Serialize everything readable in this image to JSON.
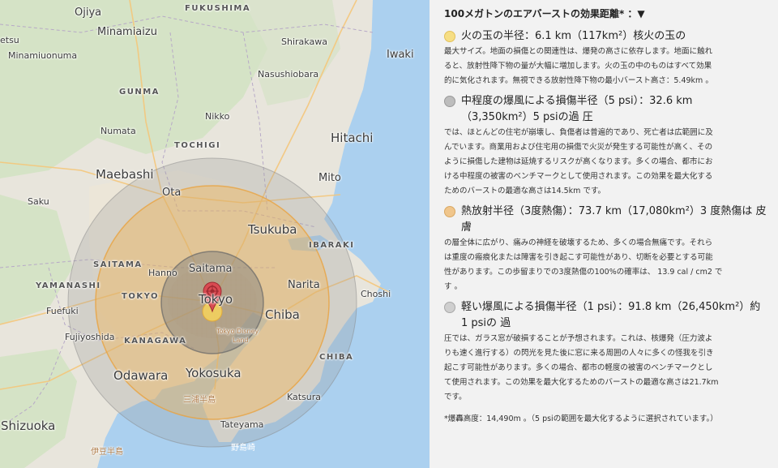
{
  "map": {
    "labels": {
      "ojiya": "Ojiya",
      "fukushima": "FUKUSHIMA",
      "minamiaizu": "Minamiaizu",
      "shirakawa": "Shirakawa",
      "iwaki": "Iwaki",
      "minamiuonuma": "Minamiuonuma",
      "nasushiobara": "Nasushiobara",
      "etsu": "etsu",
      "gunma": "GUNMA",
      "nikko": "Nikko",
      "hitachi": "Hitachi",
      "numata": "Numata",
      "tochigi": "TOCHIGI",
      "maebashi": "Maebashi",
      "mito": "Mito",
      "saku": "Saku",
      "ota": "Ota",
      "tsukuba": "Tsukuba",
      "ibaraki": "IBARAKI",
      "saitama_pref": "SAITAMA",
      "hanno": "Hanno",
      "saitama": "Saitama",
      "yamanashi": "YAMANASHI",
      "tokyo_pref": "TOKYO",
      "tokyo": "Tokyo",
      "narita": "Narita",
      "choshi": "Choshi",
      "fuefuki": "Fuefuki",
      "chiba": "Chiba",
      "fujiyoshida": "Fujiyoshida",
      "kanagawa": "KANAGAWA",
      "tokyo_disney": "Tokyo Disney",
      "land": "Land",
      "chiba_pref": "CHIBA",
      "odawara": "Odawara",
      "yokosuka": "Yokosuka",
      "katsura": "Katsura",
      "miura": "三浦半島",
      "tateyama": "Tateyama",
      "shizuoka": "Shizuoka",
      "nobozaki": "野島崎",
      "izu": "伊豆半島"
    }
  },
  "panel": {
    "title": "100メガトンのエアバーストの効果距離*  ：▼",
    "sections": [
      {
        "color": "#f6de84",
        "head": "火の玉の半径：6.1 km（117km²）核火の玉の",
        "head2": "",
        "lines": [
          "最大サイズ。地面の損傷との関連性は、爆発の高さに依存します。地面に触れ",
          "ると、放射性降下物の量が大幅に増加します。火の玉の中のものはすべて効果",
          "的に気化されます。無視できる放射性降下物の最小バースト高さ：5.49km 。"
        ]
      },
      {
        "color": "#bdbdbd",
        "head": "中程度の爆風による損傷半径（5 psi）：32.6 km",
        "head2": "（3,350km²）5 psiの過 圧",
        "lines": [
          "では、ほとんどの住宅が崩壊し、負傷者は普遍的であり、死亡者は広範囲に及",
          "んでいます。商業用および住宅用の損傷で火災が発生する可能性が高く、その",
          "ように損傷した建物は延焼するリスクが高くなります。多くの場合、都市にお",
          "ける中程度の被害のベンチマークとして使用されます。この効果を最大化する",
          "ためのバーストの最適な高さは14.5km です。"
        ]
      },
      {
        "color": "#f0c68c",
        "head": "熱放射半径（3度熱傷）：73.7 km（17,080km²）3 度熱傷は 皮",
        "head2": "膚",
        "lines": [
          "の層全体に広がり、痛みの神経を破壊するため、多くの場合無痛です。それら",
          "は重度の瘢痕化または障害を引き起こす可能性があり、切断を必要とする可能",
          "性があります。この歩留まりでの3度熱傷の100%の確率は、 13.9 cal / cm2 で",
          "す 。"
        ]
      },
      {
        "color": "#cfcfcf",
        "head": "軽い爆風による損傷半径（1 psi）：91.8 km（26,450km²）約",
        "head2": "1 psiの 過",
        "lines": [
          "圧では、ガラス窓が破損することが予想されます。これは、核爆発（圧力波よ",
          "りも速く進行する）の閃光を見た後に窓に来る周囲の人々に多くの怪我を引き",
          "起こす可能性があります。多くの場合、都市の軽度の被害のベンチマークとし",
          "て使用されます。この効果を最大化するためのバーストの最適な高さは21.7km",
          "です。"
        ]
      }
    ],
    "footnote": "*爆轟高度：14,490m 。（5 psiの範囲を最大化するように選択されています。）"
  }
}
